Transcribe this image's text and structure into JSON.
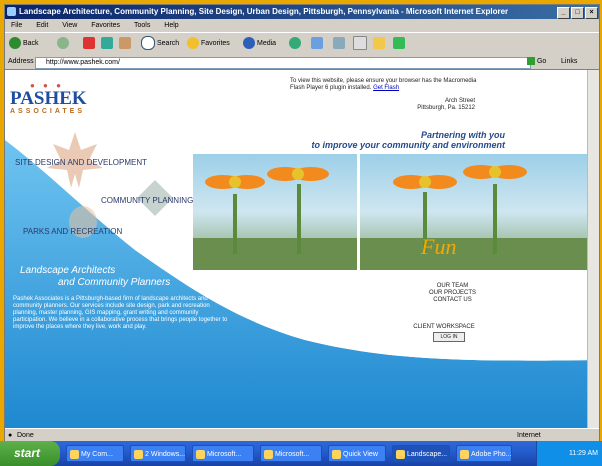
{
  "window": {
    "title": "Landscape Architecture, Community Planning, Site Design, Urban Design, Pittsburgh, Pennsylvania - Microsoft Internet Explorer",
    "min": "_",
    "max": "□",
    "close": "×"
  },
  "menu": [
    "File",
    "Edit",
    "View",
    "Favorites",
    "Tools",
    "Help"
  ],
  "toolbar": {
    "back": "Back",
    "search": "Search",
    "favorites": "Favorites",
    "media": "Media"
  },
  "address": {
    "label": "Address",
    "url": "http://www.pashek.com/",
    "go": "Go",
    "links": "Links"
  },
  "site": {
    "logo_name": "PASHEK",
    "logo_assoc": "ASSOCIATES",
    "logo_dots": "● ● ●",
    "top_note": "To view this website, please ensure your browser has the Macromedia Flash Player 6 plugin installed.",
    "top_note_link": "Get Flash",
    "address_line1": "Arch Street",
    "address_line2": "Pittsburgh, Pa. 15212",
    "tagline1": "Partnering with you",
    "tagline2": "to improve your community and environment",
    "fun": "Fun",
    "nav": {
      "site_design": "SITE DESIGN AND DEVELOPMENT",
      "community": "COMMUNITY PLANNING",
      "parks": "PARKS AND RECREATION"
    },
    "landscape1": "Landscape Architects",
    "landscape2": "and Community Planners",
    "description": "Pashek Associates is a Pittsburgh-based firm of landscape architects and community planners. Our services include site design, park and recreation planning, master planning, GIS mapping, grant writing and community participation. We believe in a collaborative process that brings people together to improve the places where they live, work and play.",
    "right_links": [
      "OUR TEAM",
      "OUR PROJECTS",
      "CONTACT US"
    ],
    "login_label": "CLIENT WORKSPACE",
    "login_button": "LOG IN"
  },
  "status": {
    "left": "Done",
    "zone": "Internet"
  },
  "taskbar": {
    "start": "start",
    "tasks": [
      "My Com...",
      "2 Windows...",
      "Microsoft...",
      "Microsoft...",
      "Quick View",
      "Landscape...",
      "Adobe Pho..."
    ],
    "clock": "11:29 AM"
  },
  "colors": {
    "accent_blue": "#1f4e9e",
    "sky_blue": "#1e88d0",
    "xp_taskbar": "#245ecf",
    "start_green": "#3a8f2c"
  }
}
